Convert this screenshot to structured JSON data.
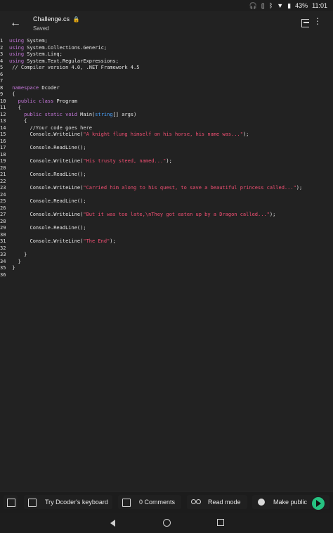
{
  "status": {
    "battery": "43%",
    "time": "11:01"
  },
  "appbar": {
    "title": "Challenge.cs",
    "subtitle": "Saved"
  },
  "code_lines": [
    {
      "n": "1",
      "parts": [
        {
          "t": "using",
          "c": "kw"
        },
        {
          "t": " System;"
        }
      ]
    },
    {
      "n": "2",
      "parts": [
        {
          "t": "using",
          "c": "kw"
        },
        {
          "t": " System.Collections.Generic;"
        }
      ]
    },
    {
      "n": "3",
      "parts": [
        {
          "t": "using",
          "c": "kw"
        },
        {
          "t": " System.Linq;"
        }
      ]
    },
    {
      "n": "4",
      "parts": [
        {
          "t": "using",
          "c": "kw"
        },
        {
          "t": " System.Text.RegularExpressions;"
        }
      ]
    },
    {
      "n": "5",
      "parts": [
        {
          "t": " // Compiler version 4.0, .NET Framework 4.5",
          "c": "comment"
        }
      ]
    },
    {
      "n": "6",
      "parts": []
    },
    {
      "n": "7",
      "parts": []
    },
    {
      "n": "8",
      "parts": [
        {
          "t": " "
        },
        {
          "t": "namespace",
          "c": "kw"
        },
        {
          "t": " Dcoder"
        }
      ]
    },
    {
      "n": "9",
      "parts": [
        {
          "t": " {"
        }
      ]
    },
    {
      "n": "10",
      "parts": [
        {
          "t": "   "
        },
        {
          "t": "public",
          "c": "kw"
        },
        {
          "t": " "
        },
        {
          "t": "class",
          "c": "kw"
        },
        {
          "t": " Program"
        }
      ]
    },
    {
      "n": "11",
      "parts": [
        {
          "t": "   {"
        }
      ]
    },
    {
      "n": "12",
      "parts": [
        {
          "t": "     "
        },
        {
          "t": "public",
          "c": "kw"
        },
        {
          "t": " "
        },
        {
          "t": "static",
          "c": "kw"
        },
        {
          "t": " "
        },
        {
          "t": "void",
          "c": "kw"
        },
        {
          "t": " Main("
        },
        {
          "t": "string",
          "c": "type"
        },
        {
          "t": "[] args)"
        }
      ]
    },
    {
      "n": "13",
      "parts": [
        {
          "t": "     {"
        }
      ]
    },
    {
      "n": "14",
      "parts": [
        {
          "t": "       //Your code goes here",
          "c": "comment"
        }
      ]
    },
    {
      "n": "15",
      "parts": [
        {
          "t": "       Console.WriteLine("
        },
        {
          "t": "\"A knight flung himself on his horse, his name was...\"",
          "c": "str"
        },
        {
          "t": ");"
        }
      ]
    },
    {
      "n": "16",
      "parts": []
    },
    {
      "n": "17",
      "parts": [
        {
          "t": "       Console.ReadLine();"
        }
      ]
    },
    {
      "n": "18",
      "parts": []
    },
    {
      "n": "19",
      "parts": [
        {
          "t": "       Console.WriteLine("
        },
        {
          "t": "\"His trusty steed, named...\"",
          "c": "str"
        },
        {
          "t": ");"
        }
      ]
    },
    {
      "n": "20",
      "parts": []
    },
    {
      "n": "21",
      "parts": [
        {
          "t": "       Console.ReadLine();"
        }
      ]
    },
    {
      "n": "22",
      "parts": []
    },
    {
      "n": "23",
      "parts": [
        {
          "t": "       Console.WriteLine("
        },
        {
          "t": "\"Carried him along to his quest, to save a beautiful princess called...\"",
          "c": "str"
        },
        {
          "t": ");"
        }
      ]
    },
    {
      "n": "24",
      "parts": []
    },
    {
      "n": "25",
      "parts": [
        {
          "t": "       Console.ReadLine();"
        }
      ]
    },
    {
      "n": "26",
      "parts": []
    },
    {
      "n": "27",
      "parts": [
        {
          "t": "       Console.WriteLine("
        },
        {
          "t": "\"But it was too late,\\nThey got eaten up by a Dragon called...\"",
          "c": "str"
        },
        {
          "t": ");"
        }
      ]
    },
    {
      "n": "28",
      "parts": []
    },
    {
      "n": "29",
      "parts": [
        {
          "t": "       Console.ReadLine();"
        }
      ]
    },
    {
      "n": "30",
      "parts": []
    },
    {
      "n": "31",
      "parts": [
        {
          "t": "       Console.WriteLine("
        },
        {
          "t": "\"The End\"",
          "c": "str"
        },
        {
          "t": ");"
        }
      ]
    },
    {
      "n": "32",
      "parts": []
    },
    {
      "n": "33",
      "parts": [
        {
          "t": "     }"
        }
      ]
    },
    {
      "n": "34",
      "parts": [
        {
          "t": "   }"
        }
      ]
    },
    {
      "n": "35",
      "parts": [
        {
          "t": " }"
        }
      ]
    },
    {
      "n": "36",
      "parts": []
    }
  ],
  "bottombar": {
    "keyboard_label": "Try Dcoder's keyboard",
    "comments_label": "0 Comments",
    "read_label": "Read mode",
    "public_label": "Make public"
  }
}
